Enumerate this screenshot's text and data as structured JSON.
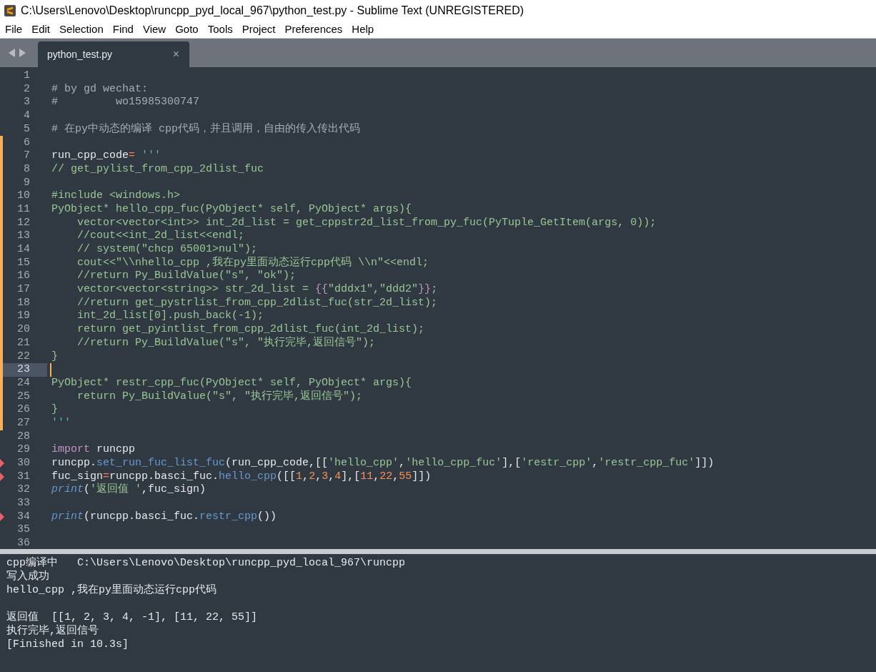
{
  "window": {
    "title": "C:\\Users\\Lenovo\\Desktop\\runcpp_pyd_local_967\\python_test.py - Sublime Text (UNREGISTERED)"
  },
  "menu": [
    "File",
    "Edit",
    "Selection",
    "Find",
    "View",
    "Goto",
    "Tools",
    "Project",
    "Preferences",
    "Help"
  ],
  "tabs": [
    {
      "label": "python_test.py",
      "selected": true,
      "close": "×"
    }
  ],
  "editor": {
    "lines": [
      {
        "number": "1",
        "selected": false
      },
      {
        "number": "2",
        "selected": false,
        "segments": [
          {
            "kind": "comment",
            "text": "# by gd wechat:"
          }
        ]
      },
      {
        "number": "3",
        "selected": false,
        "segments": [
          {
            "kind": "comment",
            "text": "#         wo15985300747"
          }
        ]
      },
      {
        "number": "4",
        "selected": false
      },
      {
        "number": "5",
        "selected": false,
        "segments": [
          {
            "kind": "comment",
            "text": "# 在py中动态的编译 cpp代码，并且调用，自由的传入传出代码"
          }
        ]
      },
      {
        "number": "6",
        "selected": false,
        "modified": true
      },
      {
        "number": "7",
        "selected": false,
        "modified": true,
        "segments": [
          {
            "kind": "plain",
            "text": "run_cpp_code"
          },
          {
            "kind": "operator",
            "text": "="
          },
          {
            "kind": "quote",
            "text": " '''"
          }
        ]
      },
      {
        "number": "8",
        "selected": false,
        "modified": true,
        "segments": [
          {
            "kind": "string",
            "text": "// get_pylist_from_cpp_2dlist_fuc"
          }
        ]
      },
      {
        "number": "9",
        "selected": false,
        "modified": true
      },
      {
        "number": "10",
        "selected": false,
        "modified": true,
        "segments": [
          {
            "kind": "string",
            "text": "#include <windows.h>"
          }
        ]
      },
      {
        "number": "11",
        "selected": false,
        "modified": true,
        "segments": [
          {
            "kind": "string",
            "text": "PyObject* hello_cpp_fuc(PyObject* self, PyObject* args){"
          }
        ]
      },
      {
        "number": "12",
        "selected": false,
        "modified": true,
        "segments": [
          {
            "kind": "string",
            "text": "    vector<vector<int>> int_2d_list = get_cppstr2d_list_from_py_fuc(PyTuple_GetItem(args, 0));"
          }
        ]
      },
      {
        "number": "13",
        "selected": false,
        "modified": true,
        "segments": [
          {
            "kind": "string",
            "text": "    //cout<<int_2d_list<<endl;"
          }
        ]
      },
      {
        "number": "14",
        "selected": false,
        "modified": true,
        "segments": [
          {
            "kind": "string",
            "text": "    // system(\"chcp 65001>nul\");"
          }
        ]
      },
      {
        "number": "15",
        "selected": false,
        "modified": true,
        "segments": [
          {
            "kind": "string",
            "text": "    cout<<\"\\\\nhello_cpp ,我在py里面动态运行cpp代码 \\\\n\"<<endl;"
          }
        ]
      },
      {
        "number": "16",
        "selected": false,
        "modified": true,
        "segments": [
          {
            "kind": "string",
            "text": "    //return Py_BuildValue(\"s\", \"ok\");"
          }
        ]
      },
      {
        "number": "17",
        "selected": false,
        "modified": true,
        "segments": [
          {
            "kind": "string",
            "text": "    vector<vector<string>> str_2d_list = "
          },
          {
            "kind": "brace",
            "text": "{{"
          },
          {
            "kind": "string",
            "text": "\"dddx1\",\"ddd2\""
          },
          {
            "kind": "brace",
            "text": "}}"
          },
          {
            "kind": "string",
            "text": ";"
          }
        ]
      },
      {
        "number": "18",
        "selected": false,
        "modified": true,
        "segments": [
          {
            "kind": "string",
            "text": "    //return get_pystrlist_from_cpp_2dlist_fuc(str_2d_list);"
          }
        ]
      },
      {
        "number": "19",
        "selected": false,
        "modified": true,
        "segments": [
          {
            "kind": "string",
            "text": "    int_2d_list[0].push_back(-1);"
          }
        ]
      },
      {
        "number": "20",
        "selected": false,
        "modified": true,
        "segments": [
          {
            "kind": "string",
            "text": "    return get_pyintlist_from_cpp_2dlist_fuc(int_2d_list);"
          }
        ]
      },
      {
        "number": "21",
        "selected": false,
        "modified": true,
        "segments": [
          {
            "kind": "string",
            "text": "    //return Py_BuildValue(\"s\", \"执行完毕,返回信号\");"
          }
        ]
      },
      {
        "number": "22",
        "selected": false,
        "modified": true,
        "segments": [
          {
            "kind": "string",
            "text": "}"
          }
        ]
      },
      {
        "number": "23",
        "selected": true,
        "modified": true
      },
      {
        "number": "24",
        "selected": false,
        "modified": true,
        "segments": [
          {
            "kind": "string",
            "text": "PyObject* restr_cpp_fuc(PyObject* self, PyObject* args){"
          }
        ]
      },
      {
        "number": "25",
        "selected": false,
        "modified": true,
        "segments": [
          {
            "kind": "string",
            "text": "    return Py_BuildValue(\"s\", \"执行完毕,返回信号\");"
          }
        ]
      },
      {
        "number": "26",
        "selected": false,
        "modified": true,
        "segments": [
          {
            "kind": "string",
            "text": "}"
          }
        ]
      },
      {
        "number": "27",
        "selected": false,
        "modified": true,
        "segments": [
          {
            "kind": "quote",
            "text": "'''"
          }
        ]
      },
      {
        "number": "28",
        "selected": false
      },
      {
        "number": "29",
        "selected": false,
        "segments": [
          {
            "kind": "keyword",
            "text": "import"
          },
          {
            "kind": "plain",
            "text": " runcpp"
          }
        ]
      },
      {
        "number": "30",
        "selected": false,
        "flagged": true,
        "segments": [
          {
            "kind": "plain",
            "text": "runcpp."
          },
          {
            "kind": "func",
            "text": "set_run_fuc_list_fuc"
          },
          {
            "kind": "plain",
            "text": "(run_cpp_code,[["
          },
          {
            "kind": "string",
            "text": "'hello_cpp'"
          },
          {
            "kind": "plain",
            "text": ","
          },
          {
            "kind": "string",
            "text": "'hello_cpp_fuc'"
          },
          {
            "kind": "plain",
            "text": "],["
          },
          {
            "kind": "string",
            "text": "'restr_cpp'"
          },
          {
            "kind": "plain",
            "text": ","
          },
          {
            "kind": "string",
            "text": "'restr_cpp_fuc'"
          },
          {
            "kind": "plain",
            "text": "]])"
          }
        ]
      },
      {
        "number": "31",
        "selected": false,
        "flagged": true,
        "segments": [
          {
            "kind": "plain",
            "text": "fuc_sign"
          },
          {
            "kind": "operator",
            "text": "="
          },
          {
            "kind": "plain",
            "text": "runcpp.basci_fuc."
          },
          {
            "kind": "func",
            "text": "hello_cpp"
          },
          {
            "kind": "plain",
            "text": "([["
          },
          {
            "kind": "number",
            "text": "1"
          },
          {
            "kind": "plain",
            "text": ","
          },
          {
            "kind": "number",
            "text": "2"
          },
          {
            "kind": "plain",
            "text": ","
          },
          {
            "kind": "number",
            "text": "3"
          },
          {
            "kind": "plain",
            "text": ","
          },
          {
            "kind": "number",
            "text": "4"
          },
          {
            "kind": "plain",
            "text": "],["
          },
          {
            "kind": "number",
            "text": "11"
          },
          {
            "kind": "plain",
            "text": ","
          },
          {
            "kind": "number",
            "text": "22"
          },
          {
            "kind": "plain",
            "text": ","
          },
          {
            "kind": "number",
            "text": "55"
          },
          {
            "kind": "plain",
            "text": "]])"
          }
        ]
      },
      {
        "number": "32",
        "selected": false,
        "segments": [
          {
            "kind": "builtin",
            "text": "print"
          },
          {
            "kind": "plain",
            "text": "("
          },
          {
            "kind": "string",
            "text": "'返回值 '"
          },
          {
            "kind": "plain",
            "text": ",fuc_sign)"
          }
        ]
      },
      {
        "number": "33",
        "selected": false
      },
      {
        "number": "34",
        "selected": false,
        "flagged": true,
        "segments": [
          {
            "kind": "builtin",
            "text": "print"
          },
          {
            "kind": "plain",
            "text": "(runcpp.basci_fuc."
          },
          {
            "kind": "func",
            "text": "restr_cpp"
          },
          {
            "kind": "plain",
            "text": "())"
          }
        ]
      },
      {
        "number": "35",
        "selected": false
      },
      {
        "number": "36",
        "selected": false
      }
    ]
  },
  "output_panel": {
    "lines": [
      {
        "text": "cpp编译中   C:\\Users\\Lenovo\\Desktop\\runcpp_pyd_local_967\\runcpp"
      },
      {
        "text": "写入成功"
      },
      {
        "text": "hello_cpp ,我在py里面动态运行cpp代码"
      },
      {
        "text": "返回值  [[1, 2, 3, 4, -1], [11, 22, 55]]",
        "blank_before": true
      },
      {
        "text": "执行完毕,返回信号"
      },
      {
        "text": "[Finished in 10.3s]"
      }
    ]
  }
}
